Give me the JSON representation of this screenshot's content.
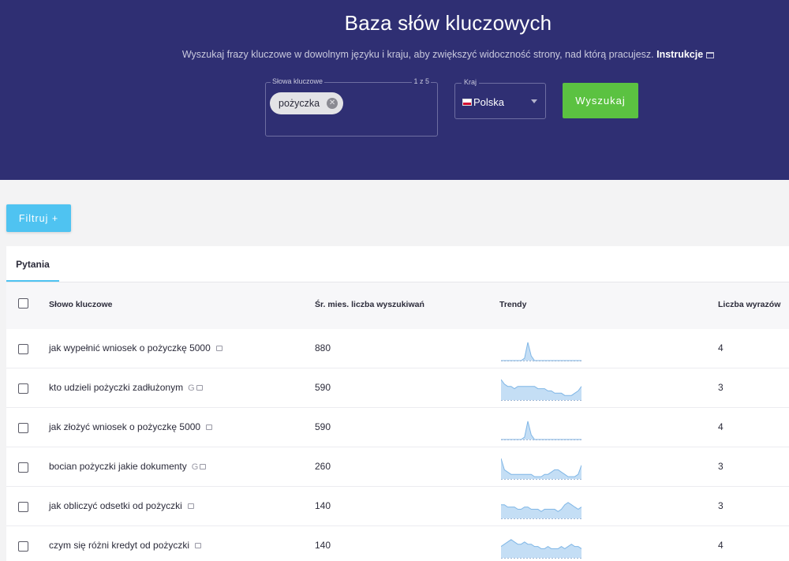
{
  "hero": {
    "title": "Baza słów kluczowych",
    "subtitle": "Wyszukaj frazy kluczowe w dowolnym języku i kraju, aby zwiększyć widoczność strony, nad którą pracujesz.",
    "instructions_link": "Instrukcje"
  },
  "search": {
    "keywords_label": "Słowa kluczowe",
    "keywords_count": "1 z 5",
    "chip": "pożyczka",
    "country_label": "Kraj",
    "country_value": "Polska",
    "submit_label": "Wyszukaj"
  },
  "filter_label": "Filtruj +",
  "tabs": [
    {
      "label": "Pytania",
      "active": true
    }
  ],
  "table": {
    "columns": [
      "Słowo kluczowe",
      "Śr. mies. liczba wyszukiwań",
      "Trendy",
      "Liczba wyrazów"
    ],
    "rows": [
      {
        "keyword": "jak wypełnić wniosek o pożyczkę 5000",
        "google": false,
        "volume": "880",
        "words": "4",
        "trend": [
          0,
          0,
          0,
          0,
          0,
          0,
          0,
          1,
          8,
          2,
          0,
          0,
          0,
          0,
          0,
          0,
          0,
          0,
          0,
          0,
          0,
          0,
          0,
          0,
          0
        ]
      },
      {
        "keyword": "kto udzieli pożyczki zadłużonym",
        "google": true,
        "volume": "590",
        "words": "3",
        "trend": [
          9,
          7,
          6,
          6,
          5,
          6,
          6,
          6,
          6,
          6,
          6,
          5,
          5,
          5,
          4,
          4,
          3,
          3,
          3,
          2,
          2,
          2,
          3,
          4,
          6
        ]
      },
      {
        "keyword": "jak złożyć wniosek o pożyczkę 5000",
        "google": false,
        "volume": "590",
        "words": "4",
        "trend": [
          0,
          0,
          0,
          0,
          0,
          0,
          0,
          1,
          8,
          2,
          0,
          0,
          0,
          0,
          0,
          0,
          0,
          0,
          0,
          0,
          0,
          0,
          0,
          0,
          0
        ]
      },
      {
        "keyword": "bocian pożyczki jakie dokumenty",
        "google": true,
        "volume": "260",
        "words": "3",
        "trend": [
          9,
          4,
          3,
          2,
          2,
          2,
          2,
          2,
          2,
          2,
          1,
          1,
          1,
          2,
          2,
          3,
          4,
          4,
          3,
          2,
          1,
          1,
          1,
          2,
          6
        ]
      },
      {
        "keyword": "jak obliczyć odsetki od pożyczki",
        "google": false,
        "volume": "140",
        "words": "3",
        "trend": [
          6,
          6,
          5,
          5,
          5,
          4,
          4,
          5,
          5,
          4,
          4,
          4,
          3,
          4,
          4,
          4,
          4,
          3,
          4,
          6,
          7,
          6,
          5,
          4,
          5
        ]
      },
      {
        "keyword": "czym się różni kredyt od pożyczki",
        "google": false,
        "volume": "140",
        "words": "4",
        "trend": [
          5,
          6,
          7,
          8,
          7,
          6,
          6,
          7,
          6,
          6,
          5,
          5,
          4,
          4,
          5,
          4,
          4,
          4,
          5,
          4,
          5,
          6,
          5,
          5,
          4
        ]
      }
    ]
  },
  "colors": {
    "hero_bg": "#2f2f73",
    "search_button": "#5bc241",
    "filter_button": "#4fc3f1",
    "tab_underline": "#4fc3f1",
    "trend_fill": "#c4def5",
    "trend_stroke": "#7fb6e6"
  }
}
